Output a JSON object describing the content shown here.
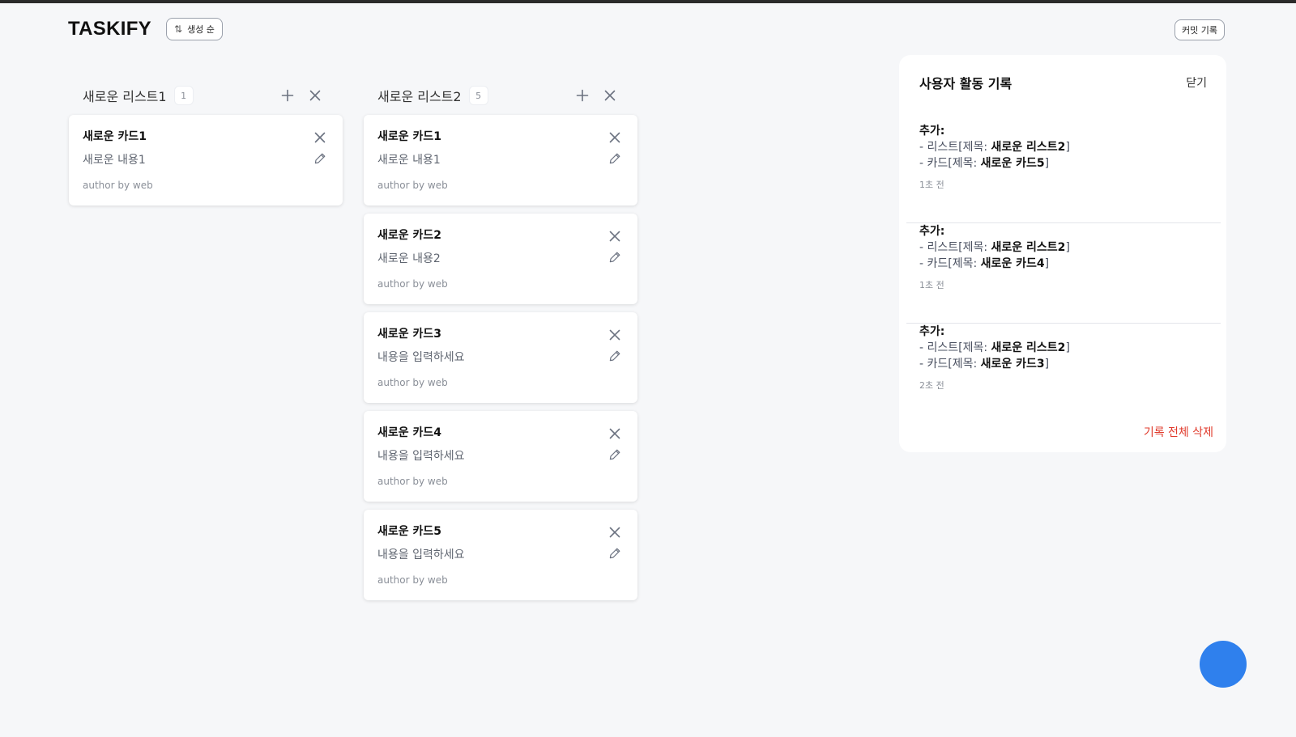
{
  "app": {
    "brand": "TASKIFY",
    "sort_label": "생성 순",
    "commit_label": "커밋 기록"
  },
  "icons": {
    "sort": "sort-arrows-icon",
    "add": "plus-icon",
    "close": "close-icon",
    "edit": "pencil-icon"
  },
  "colors": {
    "accent": "#2f80ed",
    "danger": "#e03a2b",
    "muted": "#8a8f98"
  },
  "columns": [
    {
      "title": "새로운 리스트1",
      "count": "1",
      "cards": [
        {
          "title": "새로운 카드1",
          "content": "새로운 내용1",
          "author": "author by web"
        }
      ]
    },
    {
      "title": "새로운 리스트2",
      "count": "5",
      "cards": [
        {
          "title": "새로운 카드1",
          "content": "새로운 내용1",
          "author": "author by web"
        },
        {
          "title": "새로운 카드2",
          "content": "새로운 내용2",
          "author": "author by web"
        },
        {
          "title": "새로운 카드3",
          "content": "내용을 입력하세요",
          "author": "author by web"
        },
        {
          "title": "새로운 카드4",
          "content": "내용을 입력하세요",
          "author": "author by web"
        },
        {
          "title": "새로운 카드5",
          "content": "내용을 입력하세요",
          "author": "author by web"
        }
      ]
    }
  ],
  "activity": {
    "title": "사용자 활동 기록",
    "close_label": "닫기",
    "clear_label": "기록 전체 삭제",
    "logs": [
      {
        "action": "추가:",
        "list_prefix": "- 리스트[제목: ",
        "list_title": "새로운 리스트2",
        "card_prefix": "- 카드[제목: ",
        "card_title": "새로운 카드5",
        "suffix": "]",
        "time": "1초 전"
      },
      {
        "action": "추가:",
        "list_prefix": "- 리스트[제목: ",
        "list_title": "새로운 리스트2",
        "card_prefix": "- 카드[제목: ",
        "card_title": "새로운 카드4",
        "suffix": "]",
        "time": "1초 전"
      },
      {
        "action": "추가:",
        "list_prefix": "- 리스트[제목: ",
        "list_title": "새로운 리스트2",
        "card_prefix": "- 카드[제목: ",
        "card_title": "새로운 카드3",
        "suffix": "]",
        "time": "2초 전"
      }
    ]
  }
}
